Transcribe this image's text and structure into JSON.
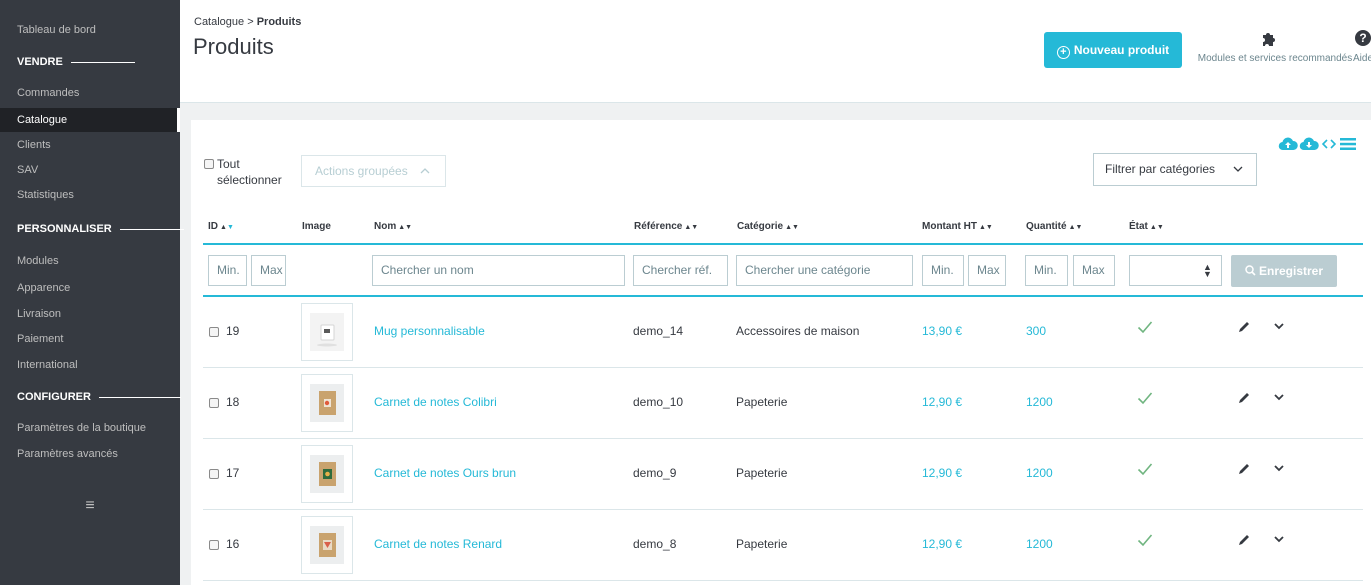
{
  "sidebar": {
    "dashboard": "Tableau de bord",
    "sections": {
      "sell": "VENDRE",
      "customize": "PERSONNALISER",
      "configure": "CONFIGURER"
    },
    "sell_items": [
      "Commandes",
      "Catalogue",
      "Clients",
      "SAV",
      "Statistiques"
    ],
    "customize_items": [
      "Modules",
      "Apparence",
      "Livraison",
      "Paiement",
      "International"
    ],
    "configure_items": [
      "Paramètres de la boutique",
      "Paramètres avancés"
    ],
    "active_item": "Catalogue",
    "menu_icon": "hamburger-icon"
  },
  "header": {
    "breadcrumb_parent": "Catalogue",
    "breadcrumb_sep": ">",
    "breadcrumb_current": "Produits",
    "title": "Produits",
    "new_product_label": "Nouveau produit",
    "modules_label": "Modules et services recommandés",
    "help_label": "Aide"
  },
  "toolbar": {
    "select_all_line1": "Tout",
    "select_all_line2": "sélectionner",
    "bulk_actions": "Actions groupées",
    "filter_categories": "Filtrer par catégories",
    "icons": [
      "cloud-upload-icon",
      "cloud-download-icon",
      "code-icon",
      "list-icon"
    ]
  },
  "table": {
    "headers": {
      "id": "ID",
      "image": "Image",
      "name": "Nom",
      "reference": "Référence",
      "category": "Catégorie",
      "price": "Montant HT",
      "quantity": "Quantité",
      "state": "État"
    },
    "filters": {
      "id_min": "Min.",
      "id_max": "Max",
      "name": "Chercher un nom",
      "reference": "Chercher réf.",
      "category": "Chercher une catégorie",
      "price_min": "Min.",
      "price_max": "Max",
      "qty_min": "Min.",
      "qty_max": "Max",
      "save": "Enregistrer"
    },
    "rows": [
      {
        "id": "19",
        "name": "Mug personnalisable",
        "reference": "demo_14",
        "category": "Accessoires de maison",
        "price": "13,90 €",
        "quantity": "300",
        "active": true
      },
      {
        "id": "18",
        "name": "Carnet de notes Colibri",
        "reference": "demo_10",
        "category": "Papeterie",
        "price": "12,90 €",
        "quantity": "1200",
        "active": true
      },
      {
        "id": "17",
        "name": "Carnet de notes Ours brun",
        "reference": "demo_9",
        "category": "Papeterie",
        "price": "12,90 €",
        "quantity": "1200",
        "active": true
      },
      {
        "id": "16",
        "name": "Carnet de notes Renard",
        "reference": "demo_8",
        "category": "Papeterie",
        "price": "12,90 €",
        "quantity": "1200",
        "active": true
      }
    ]
  },
  "colors": {
    "accent": "#25b9d7",
    "sidebar_bg": "#363a41",
    "check": "#70b580"
  }
}
